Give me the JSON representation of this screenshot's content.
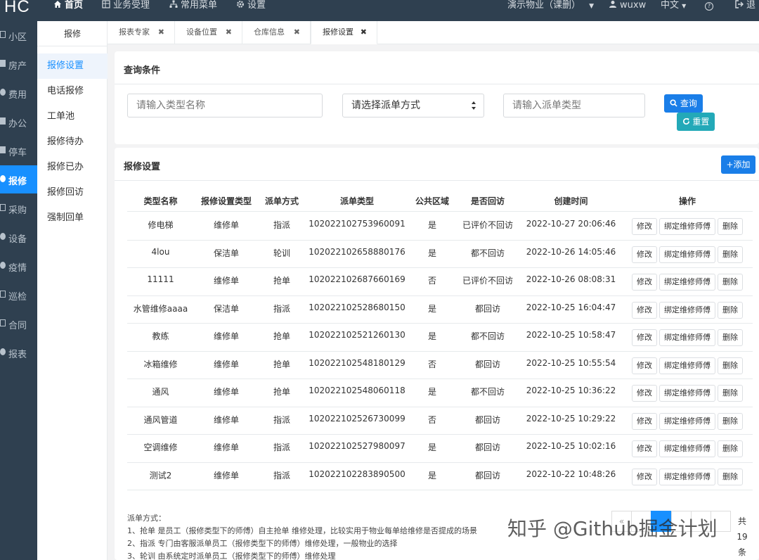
{
  "app": {
    "logo": "HC"
  },
  "topnav": {
    "home": "首页",
    "business": "业务受理",
    "common_menu": "常用菜单",
    "settings": "设置",
    "community": "演示物业（课删）",
    "user": "wuxw",
    "language": "中文",
    "help": "?",
    "logout": "退"
  },
  "sidebar": {
    "items": [
      {
        "label": "小区",
        "icon": "square-icon"
      },
      {
        "label": "房产",
        "icon": "building-icon"
      },
      {
        "label": "费用",
        "icon": "money-icon"
      },
      {
        "label": "办公",
        "icon": "office-icon"
      },
      {
        "label": "停车",
        "icon": "car-icon"
      },
      {
        "label": "报修",
        "icon": "repair-icon"
      },
      {
        "label": "采购",
        "icon": "purchase-icon"
      },
      {
        "label": "设备",
        "icon": "device-icon"
      },
      {
        "label": "疫情",
        "icon": "virus-icon"
      },
      {
        "label": "巡检",
        "icon": "inspect-icon"
      },
      {
        "label": "合同",
        "icon": "contract-icon"
      },
      {
        "label": "报表",
        "icon": "report-icon"
      }
    ],
    "active_index": 5
  },
  "submenu": {
    "title": "报修",
    "items": [
      "报修设置",
      "电话报修",
      "工单池",
      "报修待办",
      "报修已办",
      "报修回访",
      "强制回单"
    ]
  },
  "tabs": [
    {
      "label": "报表专家"
    },
    {
      "label": "设备位置"
    },
    {
      "label": "仓库信息"
    },
    {
      "label": "报修设置"
    }
  ],
  "query": {
    "title": "查询条件",
    "type_name_placeholder": "请输入类型名称",
    "dispatch_select_value": "请选择派单方式",
    "dispatch_type_placeholder": "请输入派单类型",
    "search_label": "查询",
    "reset_label": "重置"
  },
  "list": {
    "title": "报修设置",
    "add_label": "+添加",
    "columns": [
      "类型名称",
      "报修设置类型",
      "派单方式",
      "派单类型",
      "公共区域",
      "是否回访",
      "创建时间",
      "操作"
    ],
    "rows": [
      [
        "修电梯",
        "维修单",
        "指派",
        "102022102753960091",
        "是",
        "已评价不回访",
        "2022-10-27 20:06:46"
      ],
      [
        "4lou",
        "保洁单",
        "轮训",
        "102022102658880176",
        "是",
        "都不回访",
        "2022-10-26 14:05:46"
      ],
      [
        "11111",
        "维修单",
        "抢单",
        "102022102687660169",
        "否",
        "已评价不回访",
        "2022-10-26 08:08:31"
      ],
      [
        "水管维修aaaa",
        "保洁单",
        "指派",
        "102022102528680150",
        "是",
        "都回访",
        "2022-10-25 16:04:47"
      ],
      [
        "教练",
        "维修单",
        "抢单",
        "102022102521260130",
        "是",
        "都不回访",
        "2022-10-25 10:58:47"
      ],
      [
        "冰箱维修",
        "维修单",
        "抢单",
        "102022102548180129",
        "否",
        "都回访",
        "2022-10-25 10:55:54"
      ],
      [
        "通风",
        "维修单",
        "抢单",
        "102022102548060118",
        "是",
        "都不回访",
        "2022-10-25 10:36:22"
      ],
      [
        "通风管道",
        "维修单",
        "指派",
        "102022102526730099",
        "否",
        "都回访",
        "2022-10-25 10:29:22"
      ],
      [
        "空调维修",
        "维修单",
        "指派",
        "102022102527980097",
        "是",
        "都回访",
        "2022-10-25 10:02:16"
      ],
      [
        "测试2",
        "维修单",
        "指派",
        "102022102283890500",
        "是",
        "都回访",
        "2022-10-22 10:48:26"
      ]
    ],
    "op_edit": "修改",
    "op_bind": "绑定维修师傅",
    "op_delete": "删除"
  },
  "notes": {
    "title": "派单方式：",
    "line1": "1、抢单 是员工（报修类型下的师傅）自主抢单 维修处理，比较实用于物业每单给维修是否提成的场景",
    "line2": "2、指派 专门由客服派单员工（报修类型下的师傅）维修处理，一般物业的选择",
    "line3": "3、轮训 由系统定时派单员工（报修类型下的师傅）维修处理"
  },
  "pagination": {
    "prev": "«",
    "total_prefix": "共",
    "total_count": "19",
    "total_suffix": "条"
  },
  "watermark": "知乎 @Github掘金计划",
  "colors": {
    "sidebar_bg": "#2f4050",
    "accent": "#1890ff",
    "teal": "#23a9b8"
  }
}
